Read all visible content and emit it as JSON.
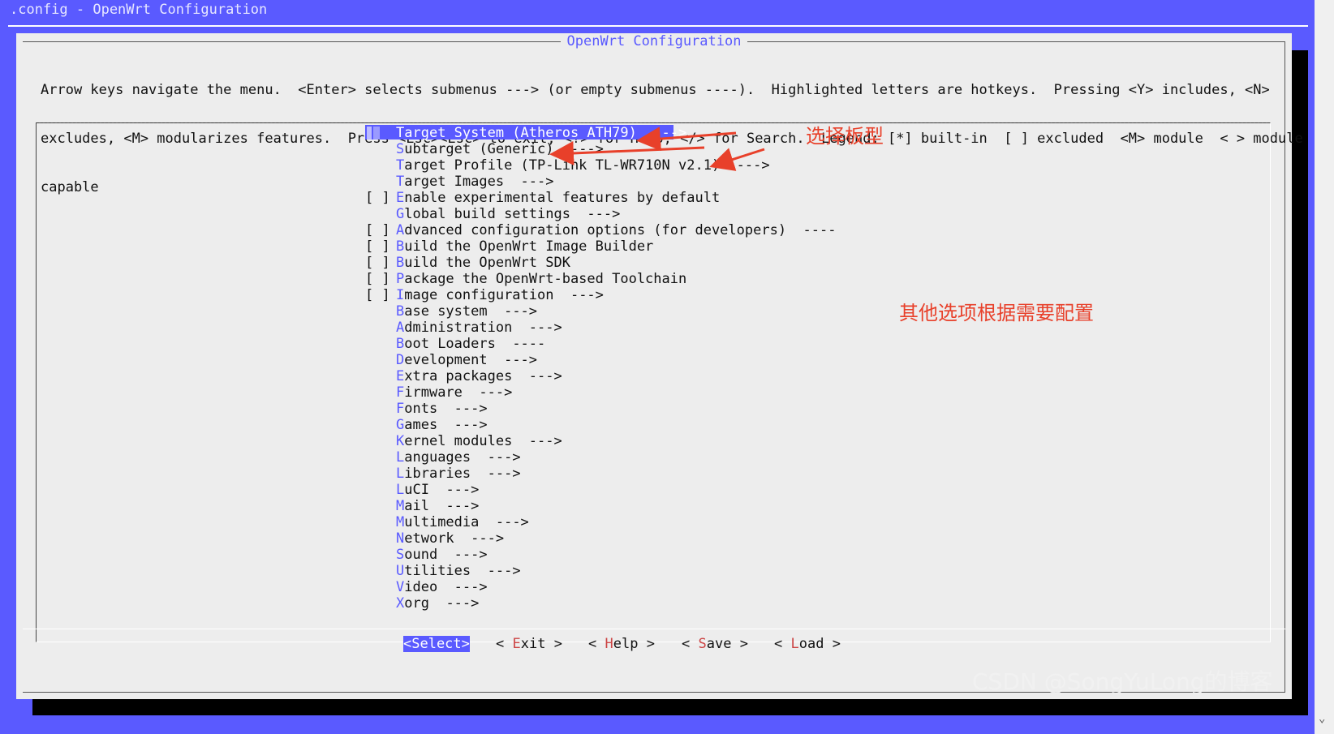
{
  "window": {
    "title": ".config - OpenWrt Configuration"
  },
  "dialog": {
    "title": "OpenWrt Configuration",
    "help_lines": [
      "Arrow keys navigate the menu.  <Enter> selects submenus ---> (or empty submenus ----).  Highlighted letters are hotkeys.  Pressing <Y> includes, <N>",
      "excludes, <M> modularizes features.  Press <Esc><Esc> to exit, <?> for Help, </> for Search.  Legend: [*] built-in  [ ] excluded  <M> module  < > module",
      "capable"
    ]
  },
  "menu": {
    "items": [
      {
        "mark": "",
        "hotkey": "T",
        "rest": "arget System (Atheros ATH79)",
        "suffix": "  --->",
        "selected": true
      },
      {
        "mark": "",
        "hotkey": "S",
        "rest": "ubtarget (Generic)",
        "suffix": "  --->"
      },
      {
        "mark": "",
        "hotkey": "T",
        "rest": "arget Profile (TP-Link TL-WR710N v2.1)",
        "suffix": "  --->"
      },
      {
        "mark": "",
        "hotkey": "T",
        "rest": "arget Images",
        "suffix": "  --->"
      },
      {
        "mark": "[ ]",
        "hotkey": "E",
        "rest": "nable experimental features by default",
        "suffix": ""
      },
      {
        "mark": "",
        "hotkey": "G",
        "rest": "lobal build settings",
        "suffix": "  --->"
      },
      {
        "mark": "[ ]",
        "hotkey": "A",
        "rest": "dvanced configuration options (for developers)",
        "suffix": "  ----"
      },
      {
        "mark": "[ ]",
        "hotkey": "B",
        "rest": "uild the OpenWrt Image Builder",
        "suffix": ""
      },
      {
        "mark": "[ ]",
        "hotkey": "B",
        "rest": "uild the OpenWrt SDK",
        "suffix": ""
      },
      {
        "mark": "[ ]",
        "hotkey": "P",
        "rest": "ackage the OpenWrt-based Toolchain",
        "suffix": ""
      },
      {
        "mark": "[ ]",
        "hotkey": "I",
        "rest": "mage configuration",
        "suffix": "  --->"
      },
      {
        "mark": "",
        "hotkey": "B",
        "rest": "ase system",
        "suffix": "  --->"
      },
      {
        "mark": "",
        "hotkey": "A",
        "rest": "dministration",
        "suffix": "  --->"
      },
      {
        "mark": "",
        "hotkey": "B",
        "rest": "oot Loaders",
        "suffix": "  ----"
      },
      {
        "mark": "",
        "hotkey": "D",
        "rest": "evelopment",
        "suffix": "  --->"
      },
      {
        "mark": "",
        "hotkey": "E",
        "rest": "xtra packages",
        "suffix": "  --->"
      },
      {
        "mark": "",
        "hotkey": "F",
        "rest": "irmware",
        "suffix": "  --->"
      },
      {
        "mark": "",
        "hotkey": "F",
        "rest": "onts",
        "suffix": "  --->"
      },
      {
        "mark": "",
        "hotkey": "G",
        "rest": "ames",
        "suffix": "  --->"
      },
      {
        "mark": "",
        "hotkey": "K",
        "rest": "ernel modules",
        "suffix": "  --->"
      },
      {
        "mark": "",
        "hotkey": "L",
        "rest": "anguages",
        "suffix": "  --->"
      },
      {
        "mark": "",
        "hotkey": "L",
        "rest": "ibraries",
        "suffix": "  --->"
      },
      {
        "mark": "",
        "hotkey": "L",
        "rest": "uCI",
        "suffix": "  --->"
      },
      {
        "mark": "",
        "hotkey": "M",
        "rest": "ail",
        "suffix": "  --->"
      },
      {
        "mark": "",
        "hotkey": "M",
        "rest": "ultimedia",
        "suffix": "  --->"
      },
      {
        "mark": "",
        "hotkey": "N",
        "rest": "etwork",
        "suffix": "  --->"
      },
      {
        "mark": "",
        "hotkey": "S",
        "rest": "ound",
        "suffix": "  --->"
      },
      {
        "mark": "",
        "hotkey": "U",
        "rest": "tilities",
        "suffix": "  --->"
      },
      {
        "mark": "",
        "hotkey": "V",
        "rest": "ideo",
        "suffix": "  --->"
      },
      {
        "mark": "",
        "hotkey": "X",
        "rest": "org",
        "suffix": "  --->"
      }
    ]
  },
  "buttons": {
    "select": "<Select>",
    "exit": {
      "pre": "< ",
      "hotkey": "E",
      "rest": "xit",
      "post": " >"
    },
    "help": {
      "pre": "< ",
      "hotkey": "H",
      "rest": "elp",
      "post": " >"
    },
    "save": {
      "pre": "< ",
      "hotkey": "S",
      "rest": "ave",
      "post": " >"
    },
    "load": {
      "pre": "< ",
      "hotkey": "L",
      "rest": "oad",
      "post": " >"
    }
  },
  "annotations": {
    "board_note": "选择板型",
    "other_note": "其他选项根据需要配置",
    "color": "#e8402a"
  },
  "watermark": "CSDN @SongYuLong的博客",
  "colors": {
    "background": "#5a5aff",
    "dialog": "#ededed",
    "hotkey": "#5a5aff",
    "button_hotkey": "#cc4444"
  }
}
